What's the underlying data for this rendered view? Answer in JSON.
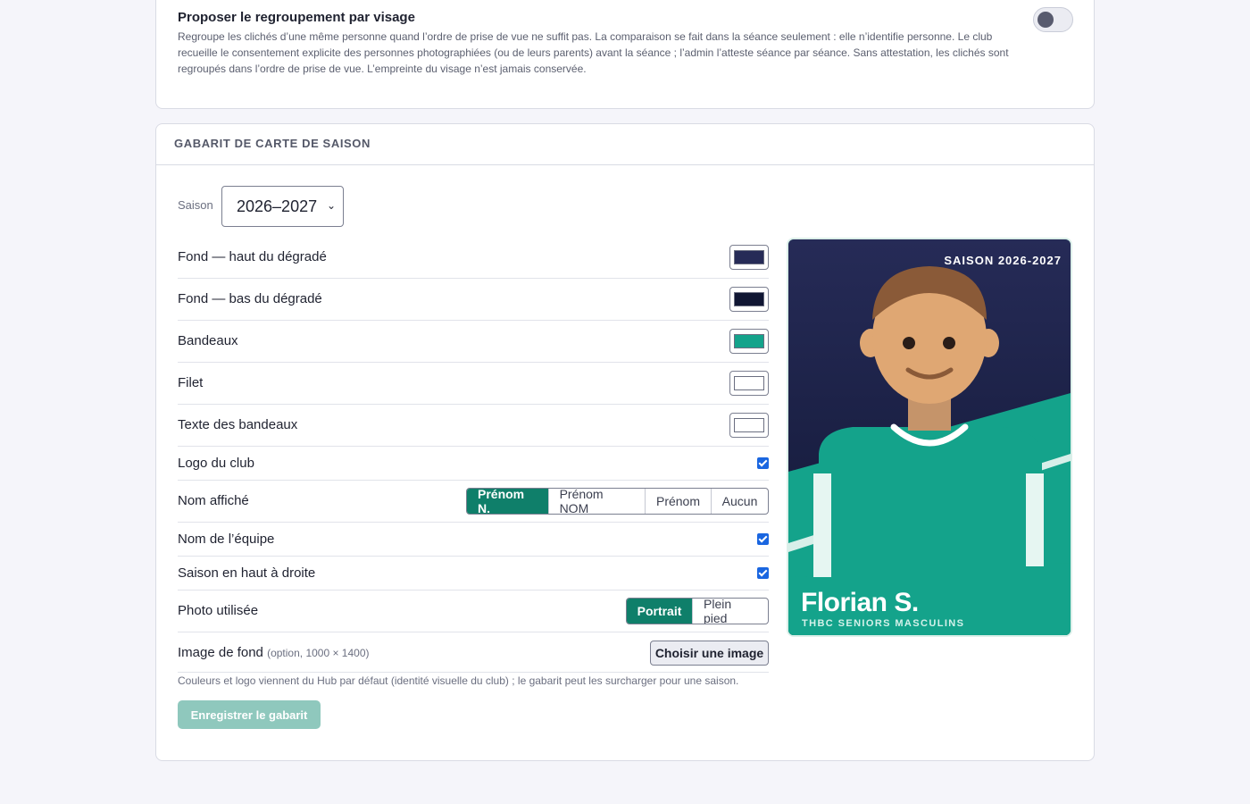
{
  "face_grouping": {
    "title": "Proposer le regroupement par visage",
    "description": "Regroupe les clichés d’une même personne quand l’ordre de prise de vue ne suffit pas. La comparaison se fait dans la séance seulement : elle n’identifie personne. Le club recueille le consentement explicite des personnes photographiées (ou de leurs parents) avant la séance ; l’admin l’atteste séance par séance. Sans attestation, les clichés sont regroupés dans l’ordre de prise de vue. L’empreinte du visage n’est jamais conservée.",
    "enabled": false
  },
  "template": {
    "section_title": "GABARIT DE CARTE DE SAISON",
    "season_label": "Saison",
    "season_value": "2026–2027",
    "colors": [
      {
        "label": "Fond — haut du dégradé",
        "value": "#262b57"
      },
      {
        "label": "Fond — bas du dégradé",
        "value": "#101633"
      },
      {
        "label": "Bandeaux",
        "value": "#14a38b"
      },
      {
        "label": "Filet",
        "value": "#ffffff"
      },
      {
        "label": "Texte des bandeaux",
        "value": "#ffffff"
      }
    ],
    "club_logo": {
      "label": "Logo du club",
      "checked": true
    },
    "display_name": {
      "label": "Nom affiché",
      "options": [
        "Prénom N.",
        "Prénom NOM",
        "Prénom",
        "Aucun"
      ],
      "selected": "Prénom N."
    },
    "team_name": {
      "label": "Nom de l’équipe",
      "checked": true
    },
    "season_top_right": {
      "label": "Saison en haut à droite",
      "checked": true
    },
    "photo": {
      "label": "Photo utilisée",
      "options": [
        "Portrait",
        "Plein pied"
      ],
      "selected": "Portrait"
    },
    "background_image": {
      "label": "Image de fond",
      "hint": "(option, 1000 × 1400)",
      "button": "Choisir une image"
    },
    "footnote": "Couleurs et logo viennent du Hub par défaut (identité visuelle du club) ; le gabarit peut les surcharger pour une saison.",
    "save_button": "Enregistrer le gabarit"
  },
  "card_preview": {
    "season": "SAISON 2026-2027",
    "player_name": "Florian S.",
    "team": "THBC SENIORS MASCULINS"
  }
}
